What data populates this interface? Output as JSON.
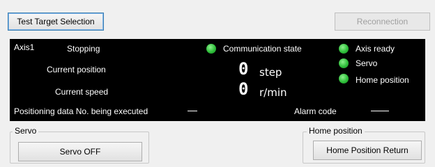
{
  "toolbar": {
    "test_target_label": "Test Target Selection",
    "reconnection_label": "Reconnection"
  },
  "status_panel": {
    "axis_label": "Axis1",
    "axis_state": "Stopping",
    "current_position_label": "Current position",
    "current_position_value": "0",
    "current_position_unit": "step",
    "current_speed_label": "Current speed",
    "current_speed_value": "0",
    "current_speed_unit": "r/min",
    "positioning_data_label": "Positioning data No. being executed",
    "alarm_code_label": "Alarm code",
    "indicators": {
      "communication_state": "Communication state",
      "axis_ready": "Axis ready",
      "servo": "Servo",
      "home_position": "Home position"
    },
    "indicator_color": "#2fbf3b"
  },
  "servo_group": {
    "title": "Servo",
    "button_label": "Servo OFF"
  },
  "home_group": {
    "title": "Home position",
    "button_label": "Home Position Return"
  }
}
